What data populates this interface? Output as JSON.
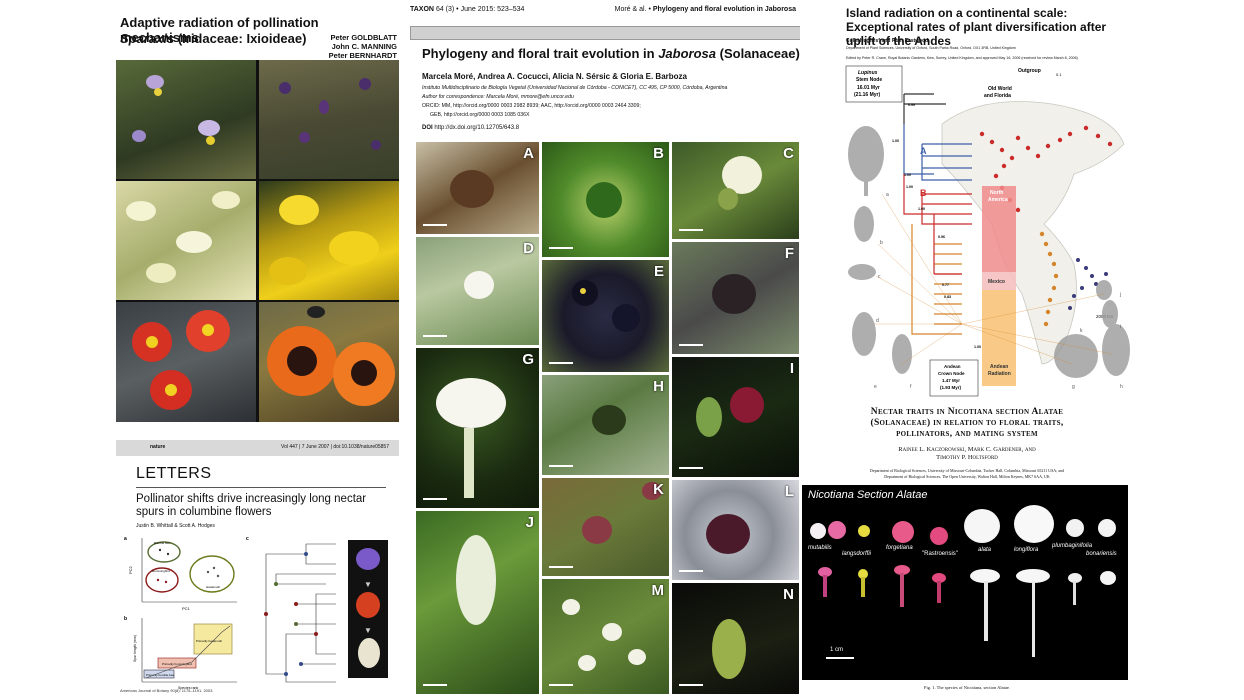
{
  "paper1": {
    "title_line1": "Adaptive radiation of pollination mechanisms",
    "title_line2_genus": "Sparaxis",
    "title_line2_rest": " (Iridaceae: Ixioideae)",
    "authors": [
      "Peter GOLDBLATT",
      "John C. MANNING",
      "Peter BERNHARDT"
    ]
  },
  "paper2": {
    "header_left": "nature",
    "header_right": "Vol 447 | 7 June 2007 | doi:10.1038/nature05857",
    "section": "LETTERS",
    "title": "Pollinator shifts drive increasingly long nectar spurs in columbine flowers",
    "authors": "Justin B. Whittall & Scott A. Hodges",
    "pca_label_a": "a",
    "pca_label_b": "b",
    "pca_label_c": "c",
    "pca_ylabel": "PC2",
    "pca_xlabel": "PC1",
    "groups": [
      "Bumble bee",
      "Hummingbird",
      "Hawkmoth"
    ],
    "box_label_1": "Primarily hawkmoth",
    "box_label_2": "Primarily hummingbird",
    "box_label_3": "Primarily bumble bee",
    "spur_ylabel": "Spur length (mm)",
    "spur_xlabel": "Species rank",
    "footer": "American Journal of Botany 90(8): 1175–1191. 2003."
  },
  "paper3": {
    "journal": "TAXON",
    "volume": "64 (3) • June 2015: 523–534",
    "running_head_authors": "Moré & al. •",
    "running_head_title": "Phylogeny and floral evolution in Jaborosa",
    "title_pre": "Phylogeny and floral trait evolution in ",
    "title_genus": "Jaborosa",
    "title_post": " (Solanaceae)",
    "authors": "Marcela Moré, Andrea A. Cocucci, Alicia N. Sérsic & Gloria E. Barboza",
    "affiliation": "Instituto Multidisciplinario de Biología Vegetal (Universidad Nacional de Córdoba - CONICET), CC 495, CP 5000, Córdoba, Argentina",
    "correspondence": "Author for correspondence: Marcela Moré, mmore@efn.uncor.edu",
    "orcid1": "ORCID: MM, http://orcid.org/0000 0003 2982 8939; AAC, http://orcid.org/0000 0003 2464 3309;",
    "orcid2": "GEB, http://orcid.org/0000 0003 1085 036X",
    "doi_label": "DOI",
    "doi": "http://dx.doi.org/10.12705/643.8",
    "panels": [
      "A",
      "B",
      "C",
      "D",
      "E",
      "F",
      "G",
      "H",
      "I",
      "J",
      "K",
      "L",
      "M",
      "N"
    ]
  },
  "paper4": {
    "title": "Island radiation on a continental scale: Exceptional rates of plant diversification after uplift of the Andes",
    "authors": "Colin Hughes* and Ruth Eastwood",
    "affiliation": "Department of Plant Sciences, University of Oxford, South Parks Road, Oxford, OX1 3RB, United Kingdom",
    "edited": "Edited by Peter R. Crane, Royal Botanic Gardens, Kew, Surrey, United Kingdom, and approved May 16, 2006 (received for review March 8, 2006)",
    "stem_node": [
      "Lupinus",
      "Stem Node",
      "16.01 Myr",
      "(21.16 Myr)"
    ],
    "outgroup": "Outgroup",
    "old_world": [
      "Old World",
      "and Florida"
    ],
    "north_america": [
      "North",
      "America"
    ],
    "mexico": "Mexico",
    "andean_radiation": [
      "Andean",
      "Radiation"
    ],
    "crown_node": [
      "Andean",
      "Crown Node",
      "1.47 Myr",
      "(1.93 Myr)"
    ],
    "support_values": [
      "0.99",
      "1.00",
      "1.00",
      "1.00",
      "1.00",
      "0.96",
      "0.77",
      "0.83",
      "1.00"
    ],
    "clade_a": "A",
    "clade_b": "B",
    "scale_km": "2000 km",
    "scale_tree": "0.1",
    "plant_letters": [
      "a",
      "b",
      "c",
      "d",
      "e",
      "f",
      "g",
      "h",
      "i",
      "j",
      "k"
    ]
  },
  "paper5": {
    "title_line1": "Nectar traits in Nicotiana section Alatae",
    "title_line2": "(Solanaceae) in relation to floral traits,",
    "title_line3": "pollinators, and mating system",
    "authors_line1": "Rainee L. Kaczorowski, Mark C. Gardener, and",
    "authors_line2": "Timothy P. Holtsford",
    "affil1": "Department of Biological Sciences, University of Missouri-Columbia, Tucker Hall, Columbia, Missouri 65211 USA; and",
    "affil2": "Department of Biological Sciences, The Open University, Walton Hall, Milton Keynes, MK7 6AA, UK",
    "figure_title": "Nicotiana Section Alatae",
    "species": [
      "mutabilis",
      "langsdorffii",
      "forgetiana",
      "\"Rastroensis\"",
      "alata",
      "longiflora",
      "plumbaginifolia",
      "bonariensis"
    ],
    "scale": "1 cm",
    "caption": "Fig. 1.   The species of Nicotiana, section Alatae."
  }
}
